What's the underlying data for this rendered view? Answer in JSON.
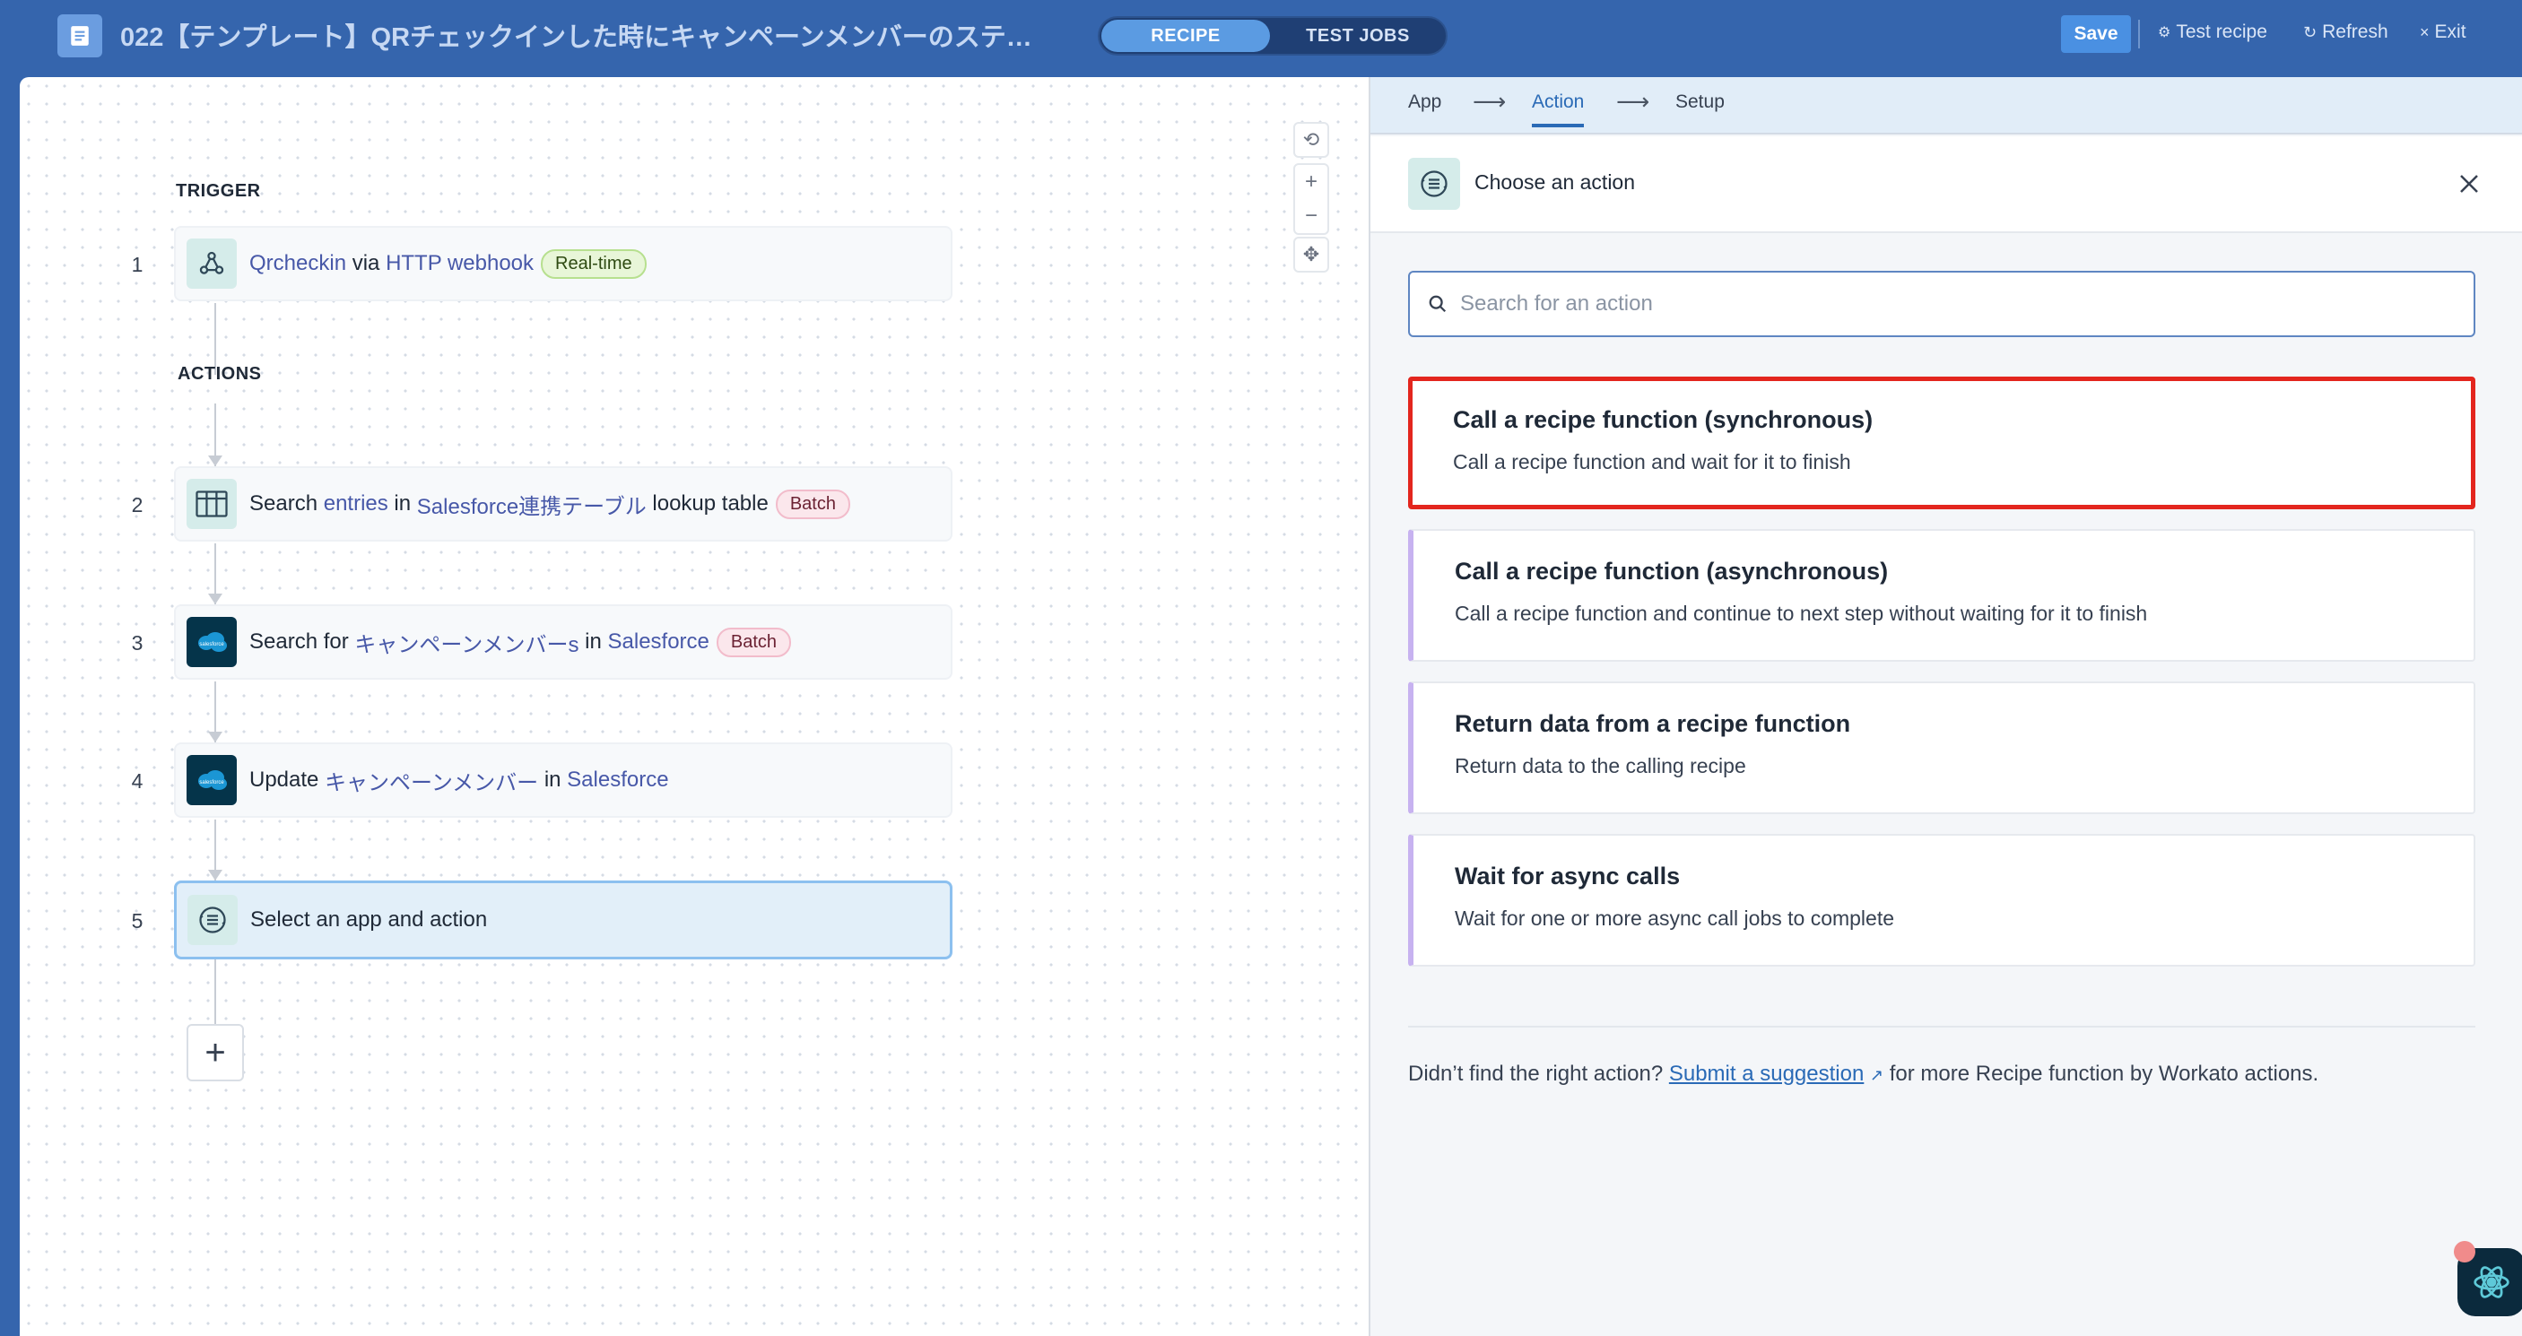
{
  "header": {
    "title": "022【テンプレート】QRチェックインした時にキャンペーンメンバーのステー...",
    "mode_recipe": "RECIPE",
    "mode_test_jobs": "TEST JOBS",
    "save_label": "Save",
    "test_recipe_label": "Test recipe",
    "refresh_label": "Refresh",
    "exit_label": "Exit"
  },
  "canvas": {
    "trigger_label": "TRIGGER",
    "actions_label": "ACTIONS",
    "steps": [
      {
        "num": "1",
        "parts": [
          "Qrcheckin",
          " via ",
          "HTTP webhook"
        ],
        "badge": "Real-time"
      },
      {
        "num": "2",
        "parts": [
          "Search ",
          "entries",
          " in ",
          "Salesforce連携テーブル",
          " lookup table"
        ],
        "badge": "Batch"
      },
      {
        "num": "3",
        "parts": [
          "Search for ",
          "キャンペーンメンバーs",
          " in ",
          "Salesforce"
        ],
        "badge": "Batch"
      },
      {
        "num": "4",
        "parts": [
          "Update ",
          "キャンペーンメンバー",
          " in ",
          "Salesforce"
        ],
        "badge": ""
      },
      {
        "num": "5",
        "parts": [
          "Select an app and action"
        ],
        "badge": ""
      }
    ],
    "add_label": "+"
  },
  "panel": {
    "crumbs": [
      "App",
      "Action",
      "Setup"
    ],
    "title": "Choose an action",
    "search_placeholder": "Search for an action",
    "options": [
      {
        "title": "Call a recipe function (synchronous)",
        "desc": "Call a recipe function and wait for it to finish"
      },
      {
        "title": "Call a recipe function (asynchronous)",
        "desc": "Call a recipe function and continue to next step without waiting for it to finish"
      },
      {
        "title": "Return data from a recipe function",
        "desc": "Return data to the calling recipe"
      },
      {
        "title": "Wait for async calls",
        "desc": "Wait for one or more async call jobs to complete"
      }
    ],
    "footer_prefix": "Didn’t find the right action?",
    "footer_link": "Submit a suggestion",
    "footer_suffix": "for more Recipe function by Workato actions."
  },
  "colors": {
    "header_bg": "#3565ad",
    "accent": "#2a6ab6",
    "selection_outline": "#e3261e"
  }
}
